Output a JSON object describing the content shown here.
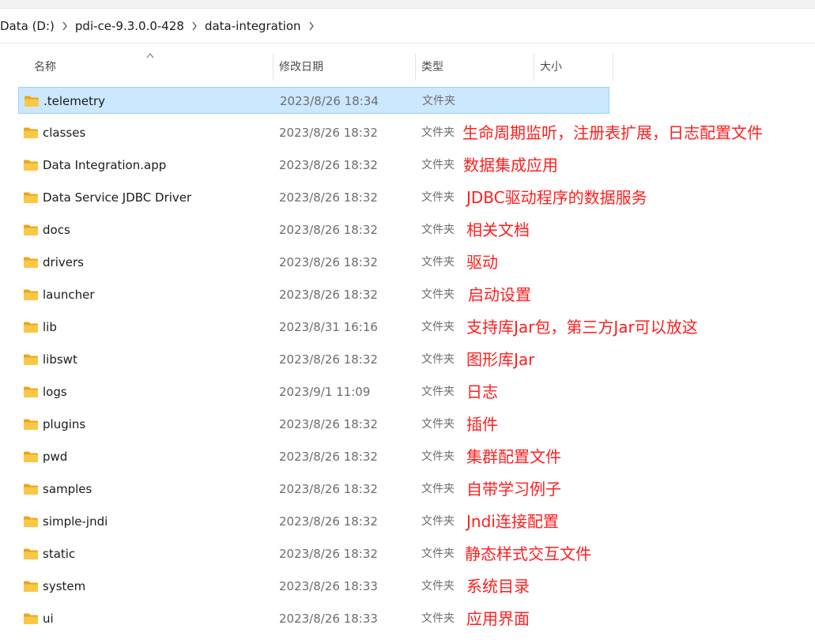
{
  "breadcrumb": [
    "Data (D:)",
    "pdi-ce-9.3.0.0-428",
    "data-integration"
  ],
  "columns": {
    "name": "名称",
    "date": "修改日期",
    "type": "类型",
    "size": "大小"
  },
  "rows": [
    {
      "name": ".telemetry",
      "date": "2023/8/26 18:34",
      "type": "文件夹",
      "annotation": "",
      "selected": true
    },
    {
      "name": "classes",
      "date": "2023/8/26 18:32",
      "type": "文件夹",
      "annotation": "生命周期监听，注册表扩展，日志配置文件"
    },
    {
      "name": "Data Integration.app",
      "date": "2023/8/26 18:32",
      "type": "文件夹",
      "annotation": "数据集成应用"
    },
    {
      "name": "Data Service JDBC Driver",
      "date": "2023/8/26 18:32",
      "type": "文件夹",
      "annotation": "JDBC驱动程序的数据服务"
    },
    {
      "name": "docs",
      "date": "2023/8/26 18:32",
      "type": "文件夹",
      "annotation": "相关文档"
    },
    {
      "name": "drivers",
      "date": "2023/8/26 18:32",
      "type": "文件夹",
      "annotation": "驱动"
    },
    {
      "name": "launcher",
      "date": "2023/8/26 18:32",
      "type": "文件夹",
      "annotation": "启动设置"
    },
    {
      "name": "lib",
      "date": "2023/8/31 16:16",
      "type": "文件夹",
      "annotation": "支持库Jar包，第三方Jar可以放这"
    },
    {
      "name": "libswt",
      "date": "2023/8/26 18:32",
      "type": "文件夹",
      "annotation": "图形库Jar"
    },
    {
      "name": "logs",
      "date": "2023/9/1 11:09",
      "type": "文件夹",
      "annotation": "日志"
    },
    {
      "name": "plugins",
      "date": "2023/8/26 18:32",
      "type": "文件夹",
      "annotation": "插件"
    },
    {
      "name": "pwd",
      "date": "2023/8/26 18:32",
      "type": "文件夹",
      "annotation": "集群配置文件"
    },
    {
      "name": "samples",
      "date": "2023/8/26 18:32",
      "type": "文件夹",
      "annotation": "自带学习例子"
    },
    {
      "name": "simple-jndi",
      "date": "2023/8/26 18:32",
      "type": "文件夹",
      "annotation": "Jndi连接配置"
    },
    {
      "name": "static",
      "date": "2023/8/26 18:32",
      "type": "文件夹",
      "annotation": "静态样式交互文件"
    },
    {
      "name": "system",
      "date": "2023/8/26 18:33",
      "type": "文件夹",
      "annotation": "系统目录"
    },
    {
      "name": "ui",
      "date": "2023/8/26 18:33",
      "type": "文件夹",
      "annotation": "应用界面"
    }
  ],
  "colors": {
    "selection_bg": "#cce8ff",
    "selection_border": "#99d1ff",
    "folder": "#f8c847",
    "annotation": "#ff1e1e"
  },
  "icons": {
    "folder": "folder-icon",
    "chevron": "chevron-right-icon",
    "sort": "sort-ascending-icon"
  }
}
